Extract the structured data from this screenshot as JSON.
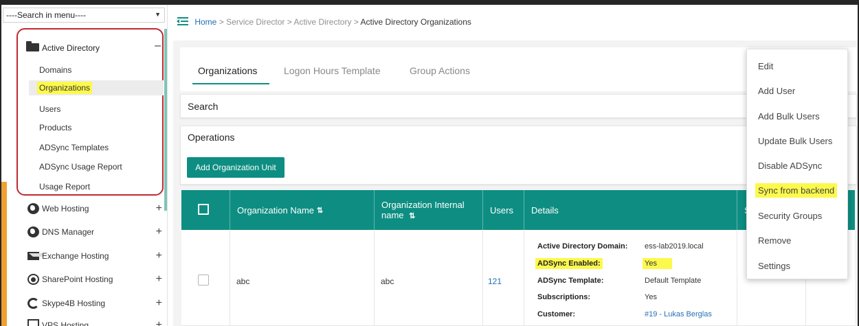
{
  "sidebar": {
    "search_placeholder": "----Search in menu----",
    "active_group": {
      "label": "Active Directory",
      "toggle": "–",
      "items": [
        {
          "label": "Domains"
        },
        {
          "label": "Organizations"
        },
        {
          "label": "Users"
        },
        {
          "label": "Products"
        },
        {
          "label": "ADSync Templates"
        },
        {
          "label": "ADSync Usage Report"
        },
        {
          "label": "Usage Report"
        }
      ]
    },
    "groups": [
      {
        "label": "Web Hosting",
        "icon": "globe-icon"
      },
      {
        "label": "DNS Manager",
        "icon": "globe-icon"
      },
      {
        "label": "Exchange Hosting",
        "icon": "envelope-icon"
      },
      {
        "label": "SharePoint Hosting",
        "icon": "sharepoint-icon"
      },
      {
        "label": "Skype4B Hosting",
        "icon": "skype-icon"
      },
      {
        "label": "VPS Hosting",
        "icon": "monitor-icon"
      }
    ],
    "expand_symbol": "+"
  },
  "breadcrumb": {
    "home": "Home",
    "sep": ">",
    "service_director": "Service Director",
    "active_directory": "Active Directory",
    "current": "Active Directory Organizations"
  },
  "tabs": [
    {
      "label": "Organizations",
      "active": true
    },
    {
      "label": "Logon Hours Template",
      "active": false
    },
    {
      "label": "Group Actions",
      "active": false
    }
  ],
  "search": {
    "title": "Search"
  },
  "operations": {
    "title": "Operations",
    "add_button": "Add Organization Unit"
  },
  "table": {
    "columns": {
      "name": "Organization Name",
      "internal_line1": "Organization Internal",
      "internal_line2": "name",
      "users": "Users",
      "details": "Details",
      "status_partial": "St"
    },
    "sort_symbol": "⇅",
    "rows": [
      {
        "name": "abc",
        "internal_name": "abc",
        "users": "121",
        "details": [
          {
            "label": "Active Directory Domain:",
            "value": "ess-lab2019.local"
          },
          {
            "label": "ADSync Enabled:",
            "value": "Yes"
          },
          {
            "label": "ADSync Template:",
            "value": "Default Template"
          },
          {
            "label": "Subscriptions:",
            "value": "Yes"
          },
          {
            "label": "Customer:",
            "value": "#19 - Lukas Berglas"
          }
        ]
      }
    ]
  },
  "dropdown": {
    "items": [
      {
        "label": "Edit"
      },
      {
        "label": "Add User"
      },
      {
        "label": "Add Bulk Users"
      },
      {
        "label": "Update Bulk Users"
      },
      {
        "label": "Disable ADSync"
      },
      {
        "label": "Sync from backend"
      },
      {
        "label": "Security Groups"
      },
      {
        "label": "Remove"
      },
      {
        "label": "Settings"
      }
    ]
  },
  "colors": {
    "accent": "#0e8e82",
    "highlight": "#fcf94d",
    "annotation_red": "#c0282d",
    "link": "#1f6fb6"
  }
}
